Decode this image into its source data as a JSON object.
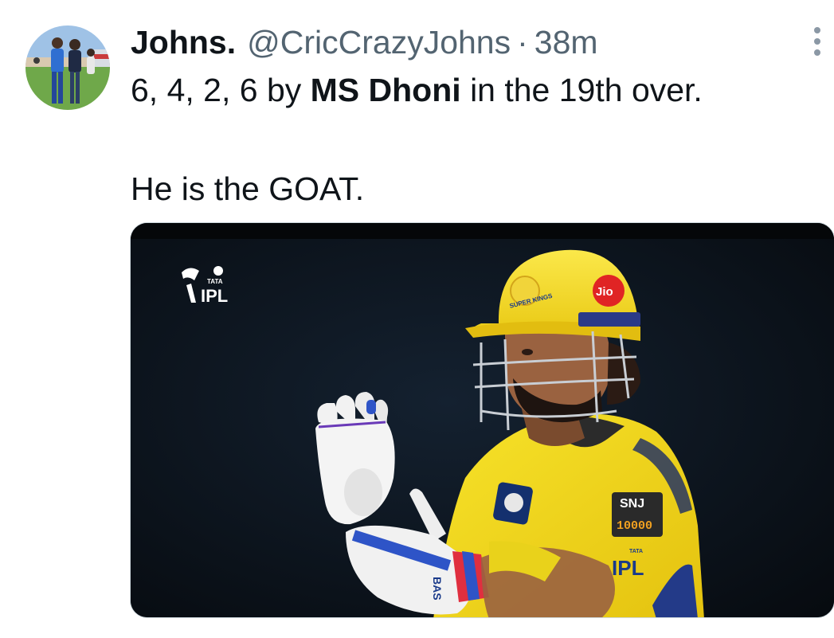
{
  "tweet": {
    "display_name": "Johns.",
    "handle": "@CricCrazyJohns",
    "separator": "·",
    "time": "38m",
    "text_prefix": "6, 4, 2, 6 by ",
    "text_bold": "MS Dhoni",
    "text_suffix": " in the 19th over.",
    "text_line2": "He is the GOAT."
  },
  "media": {
    "logo_tata": "TATA",
    "logo_ipl": "IPL",
    "helmet_sponsor": "Jio",
    "helmet_badge": "SUPER KINGS",
    "jersey_patch": "SNJ",
    "jersey_patch_sub": "10000",
    "jersey_ipl_tata": "TATA",
    "jersey_ipl": "IPL",
    "glove_text": "BAS"
  },
  "colors": {
    "text_primary": "#0f1419",
    "text_secondary": "#536471",
    "csk_yellow": "#f5e21b"
  }
}
